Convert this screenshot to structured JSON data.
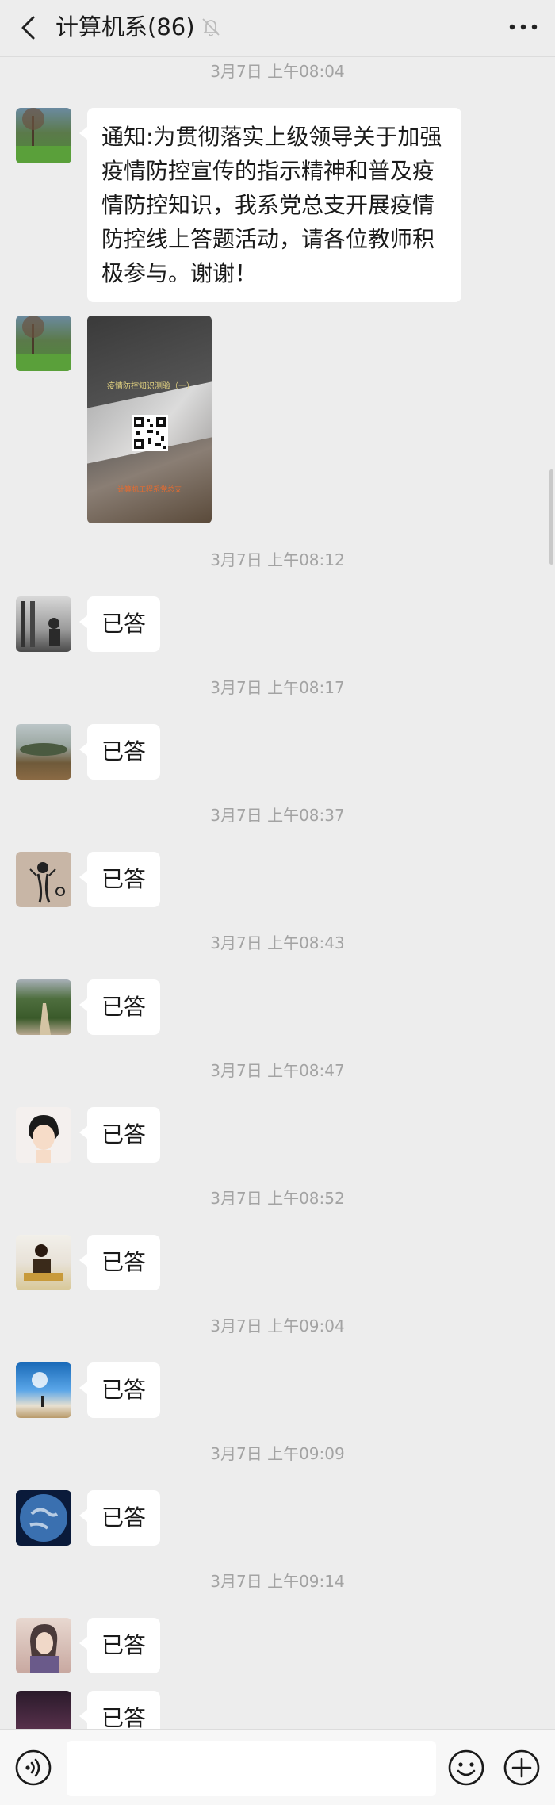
{
  "header": {
    "title": "计算机系(86)",
    "back_icon": "chevron-left-icon",
    "mute_icon": "bell-off-icon",
    "more_icon": "more-dots-icon"
  },
  "messages": [
    {
      "type": "time",
      "text": "3月7日 上午08:04"
    },
    {
      "type": "text",
      "avatar": "avatar-1",
      "text_lines": [
        "通知:为贯彻落实上级领导关于加强",
        "疫情防控宣传的指示精神和普及疫",
        "情防控知识，我系党总支开展疫情",
        "防控线上答题活动，请各位教师积",
        "极参与。谢谢！"
      ]
    },
    {
      "type": "image",
      "avatar": "avatar-1",
      "caption": "疫情防控知识测验（一）",
      "footer": "计算机工程系党总支"
    },
    {
      "type": "time",
      "text": "3月7日 上午08:12"
    },
    {
      "type": "text",
      "avatar": "avatar-2",
      "text": "已答"
    },
    {
      "type": "time",
      "text": "3月7日 上午08:17"
    },
    {
      "type": "text",
      "avatar": "avatar-3",
      "text": "已答"
    },
    {
      "type": "time",
      "text": "3月7日 上午08:37"
    },
    {
      "type": "text",
      "avatar": "avatar-4",
      "text": "已答"
    },
    {
      "type": "time",
      "text": "3月7日 上午08:43"
    },
    {
      "type": "text",
      "avatar": "avatar-5",
      "text": "已答"
    },
    {
      "type": "time",
      "text": "3月7日 上午08:47"
    },
    {
      "type": "text",
      "avatar": "avatar-6",
      "text": "已答"
    },
    {
      "type": "time",
      "text": "3月7日 上午08:52"
    },
    {
      "type": "text",
      "avatar": "avatar-7",
      "text": "已答"
    },
    {
      "type": "time",
      "text": "3月7日 上午09:04"
    },
    {
      "type": "text",
      "avatar": "avatar-8",
      "text": "已答"
    },
    {
      "type": "time",
      "text": "3月7日 上午09:09"
    },
    {
      "type": "text",
      "avatar": "avatar-9",
      "text": "已答"
    },
    {
      "type": "time",
      "text": "3月7日 上午09:14"
    },
    {
      "type": "text",
      "avatar": "avatar-10",
      "text": "已答"
    },
    {
      "type": "text",
      "avatar": "avatar-11",
      "text": "已答"
    }
  ],
  "bottombar": {
    "voice_icon": "voice-icon",
    "input_value": "",
    "emoji_icon": "emoji-icon",
    "plus_icon": "plus-icon"
  }
}
